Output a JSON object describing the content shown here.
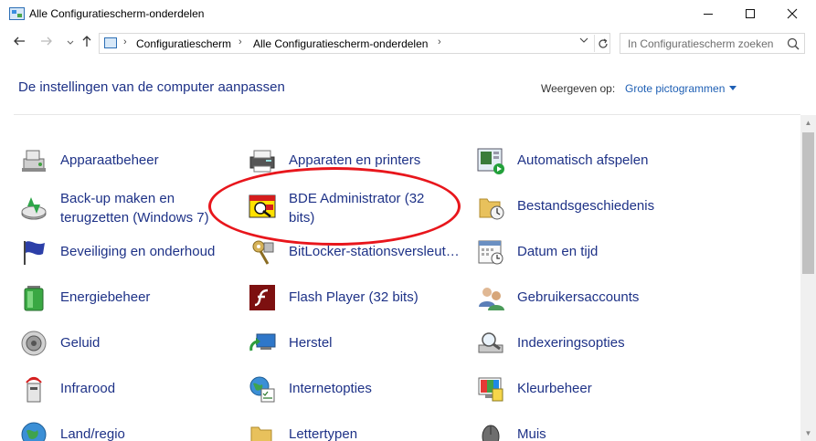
{
  "window": {
    "title": "Alle Configuratiescherm-onderdelen"
  },
  "address": {
    "crumbs": [
      "Configuratiescherm",
      "Alle Configuratiescherm-onderdelen"
    ]
  },
  "search": {
    "placeholder": "In Configuratiescherm zoeken"
  },
  "header": {
    "title": "De instellingen van de computer aanpassen",
    "view_label": "Weergeven op:",
    "view_value": "Grote pictogrammen"
  },
  "items": [
    {
      "label": "Apparaatbeheer",
      "icon": "device-manager-icon"
    },
    {
      "label": "Apparaten en printers",
      "icon": "devices-printers-icon"
    },
    {
      "label": "Automatisch afspelen",
      "icon": "autoplay-icon"
    },
    {
      "label": "Back-up maken en terugzetten (Windows 7)",
      "icon": "backup-restore-icon"
    },
    {
      "label": "BDE Administrator (32 bits)",
      "icon": "bde-administrator-icon"
    },
    {
      "label": "Bestandsgeschiedenis",
      "icon": "file-history-icon"
    },
    {
      "label": "Beveiliging en onderhoud",
      "icon": "security-flag-icon"
    },
    {
      "label": "BitLocker-stationsversleut…",
      "icon": "bitlocker-key-icon"
    },
    {
      "label": "Datum en tijd",
      "icon": "calendar-clock-icon"
    },
    {
      "label": "Energiebeheer",
      "icon": "battery-icon"
    },
    {
      "label": "Flash Player (32 bits)",
      "icon": "flash-player-icon"
    },
    {
      "label": "Gebruikersaccounts",
      "icon": "user-accounts-icon"
    },
    {
      "label": "Geluid",
      "icon": "speaker-icon"
    },
    {
      "label": "Herstel",
      "icon": "recovery-icon"
    },
    {
      "label": "Indexeringsopties",
      "icon": "indexing-icon"
    },
    {
      "label": "Infrarood",
      "icon": "infrared-icon"
    },
    {
      "label": "Internetopties",
      "icon": "internet-options-icon"
    },
    {
      "label": "Kleurbeheer",
      "icon": "color-management-icon"
    },
    {
      "label": "Land/regio",
      "icon": "globe-icon"
    },
    {
      "label": "Lettertypen",
      "icon": "fonts-folder-icon"
    },
    {
      "label": "Muis",
      "icon": "mouse-icon"
    }
  ],
  "colors": {
    "link": "#1e3287",
    "annotation": "#e8161c"
  }
}
